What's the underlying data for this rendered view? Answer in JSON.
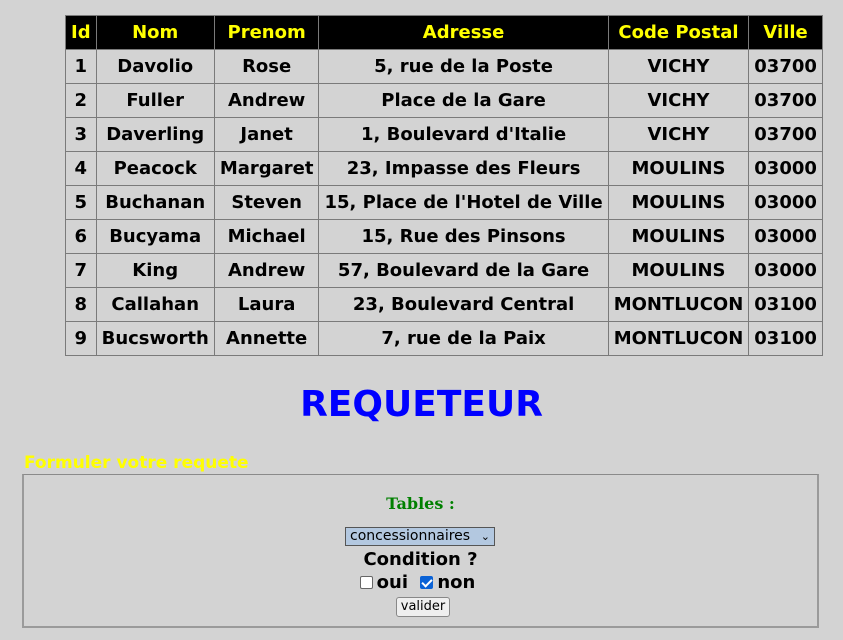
{
  "table": {
    "headers": [
      "Id",
      "Nom",
      "Prenom",
      "Adresse",
      "Code Postal",
      "Ville"
    ],
    "rows": [
      [
        "1",
        "Davolio",
        "Rose",
        "5, rue de la Poste",
        "VICHY",
        "03700"
      ],
      [
        "2",
        "Fuller",
        "Andrew",
        "Place de la Gare",
        "VICHY",
        "03700"
      ],
      [
        "3",
        "Daverling",
        "Janet",
        "1, Boulevard d'Italie",
        "VICHY",
        "03700"
      ],
      [
        "4",
        "Peacock",
        "Margaret",
        "23, Impasse des Fleurs",
        "MOULINS",
        "03000"
      ],
      [
        "5",
        "Buchanan",
        "Steven",
        "15, Place de l'Hotel de Ville",
        "MOULINS",
        "03000"
      ],
      [
        "6",
        "Bucyama",
        "Michael",
        "15, Rue des Pinsons",
        "MOULINS",
        "03000"
      ],
      [
        "7",
        "King",
        "Andrew",
        "57, Boulevard de la Gare",
        "MOULINS",
        "03000"
      ],
      [
        "8",
        "Callahan",
        "Laura",
        "23, Boulevard Central",
        "MONTLUCON",
        "03100"
      ],
      [
        "9",
        "Bucsworth",
        "Annette",
        "7, rue de la Paix",
        "MONTLUCON",
        "03100"
      ]
    ]
  },
  "title": "REQUETEUR",
  "form": {
    "legend": "Formuler votre requete",
    "tables_label": "Tables :",
    "tables_selected": "concessionnaires",
    "condition_label": "Condition ?",
    "option_oui": "oui",
    "option_non": "non",
    "oui_checked": false,
    "non_checked": true,
    "submit_label": "valider"
  },
  "colors": {
    "background": "#d3d3d3",
    "header_bg": "#000000",
    "header_text": "#ffff00",
    "title": "#0000ff",
    "legend": "#ffff00",
    "tables_label": "#008000"
  }
}
